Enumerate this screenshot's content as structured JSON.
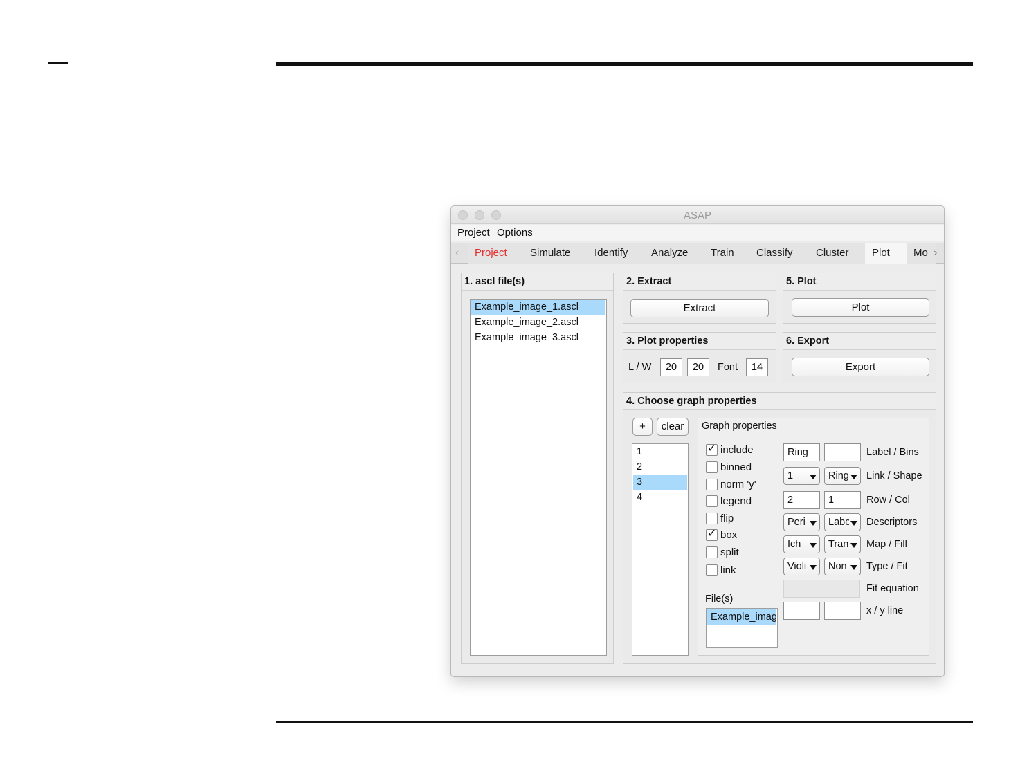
{
  "window": {
    "title": "ASAP"
  },
  "menu": [
    "Project",
    "Options"
  ],
  "tabs": [
    {
      "label": "Project",
      "state": "red"
    },
    {
      "label": "Simulate"
    },
    {
      "label": "Identify"
    },
    {
      "label": "Analyze"
    },
    {
      "label": "Train"
    },
    {
      "label": "Classify"
    },
    {
      "label": "Cluster"
    },
    {
      "label": "Plot",
      "state": "active"
    },
    {
      "label": "Mo"
    }
  ],
  "files_panel": {
    "title": "1. ascl file(s)",
    "items": [
      "Example_image_1.ascl",
      "Example_image_2.ascl",
      "Example_image_3.ascl"
    ],
    "selected_index": 0
  },
  "extract_panel": {
    "title": "2. Extract",
    "button": "Extract"
  },
  "plot_panel": {
    "title": "5. Plot",
    "button": "Plot"
  },
  "plot_properties": {
    "title": "3. Plot properties",
    "lw_label": "L / W",
    "length": "20",
    "width": "20",
    "font_label": "Font",
    "font": "14"
  },
  "export_panel": {
    "title": "6. Export",
    "button": "Export"
  },
  "graph_panel": {
    "title": "4. Choose graph properties",
    "add_button": "+",
    "clear_button": "clear",
    "graph_list": [
      "1",
      "2",
      "3",
      "4"
    ],
    "selected_graph_index": 2,
    "properties_title": "Graph properties",
    "checkboxes": [
      {
        "label": "include",
        "checked": true
      },
      {
        "label": "binned",
        "checked": false
      },
      {
        "label": "norm 'y'",
        "checked": false
      },
      {
        "label": "legend",
        "checked": false
      },
      {
        "label": "flip",
        "checked": false
      },
      {
        "label": "box",
        "checked": true
      },
      {
        "label": "split",
        "checked": false
      },
      {
        "label": "link",
        "checked": false
      }
    ],
    "files_label": "File(s)",
    "files": [
      "Example_imag"
    ],
    "label_value": "Ring",
    "bins_value": "",
    "label_bins": "Label / Bins",
    "link_value": "1",
    "shape_value": "Ring",
    "link_shape": "Link / Shape",
    "row_value": "2",
    "col_value": "1",
    "row_col": "Row / Col",
    "descriptor_1": "Peri",
    "descriptor_2": "Label",
    "descriptors": "Descriptors",
    "map_value": "Ich",
    "fill_value": "Tran",
    "map_fill": "Map / Fill",
    "type_value": "Violi",
    "fit_value": "Non",
    "type_fit": "Type / Fit",
    "fit_equation_value": "",
    "fit_equation": "Fit equation",
    "x_line_value": "",
    "y_line_value": "",
    "xy_line": "x / y line"
  }
}
